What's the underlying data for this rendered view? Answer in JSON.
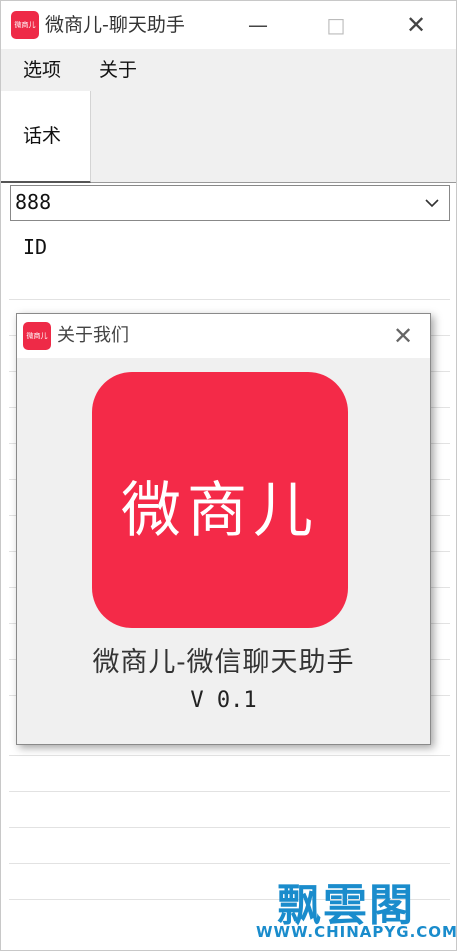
{
  "window": {
    "title": "微商儿-聊天助手",
    "icon_text": "微商儿",
    "minimize_glyph": "—",
    "maximize_glyph": "□",
    "close_glyph": "✕"
  },
  "menubar": {
    "options": "选项",
    "about": "关于"
  },
  "tabs": [
    {
      "label": "话术",
      "active": true
    }
  ],
  "combo": {
    "value": "888"
  },
  "id_label": "ID",
  "about_dialog": {
    "title": "关于我们",
    "icon_text": "微商儿",
    "close_glyph": "✕",
    "logo_text": "微商儿",
    "app_name": "微商儿-微信聊天助手",
    "version": "V 0.1"
  },
  "watermark": {
    "main": "飘雲閣",
    "sub": "WWW.CHINAPYG.COM"
  },
  "colors": {
    "brand_red": "#f42a48",
    "watermark_blue": "#1a8ccc",
    "menubar_bg": "#f0f0f0"
  }
}
